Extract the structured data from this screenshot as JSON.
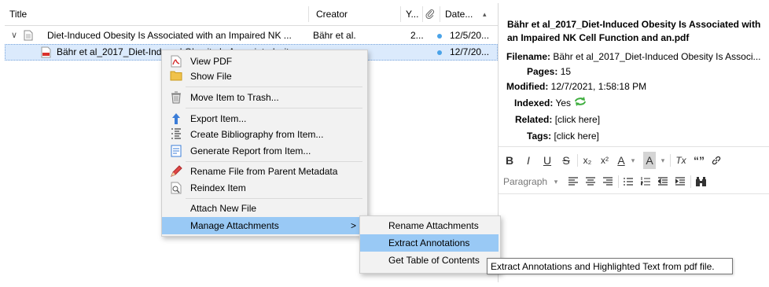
{
  "columns": {
    "title": "Title",
    "creator": "Creator",
    "year": "Y...",
    "attachment_icon": "paperclip-icon",
    "date": "Date...",
    "sort_indicator": "▴"
  },
  "rows": [
    {
      "title": "Diet-Induced Obesity Is Associated with an Impaired NK ...",
      "creator": "Bähr et al.",
      "year": "2...",
      "date": "12/5/20...",
      "expand_glyph": "∨"
    },
    {
      "title": "Bähr et al_2017_Diet-Induced Obesity Is Associated wit...",
      "creator": "",
      "year": "",
      "date": "12/7/20..."
    }
  ],
  "context_menu": {
    "items": [
      {
        "label": "View PDF",
        "icon": "pdf-icon"
      },
      {
        "label": "Show File",
        "icon": "folder-icon"
      },
      {
        "label": "Move Item to Trash...",
        "icon": "trash-icon"
      },
      {
        "label": "Export Item...",
        "icon": "export-arrow-icon"
      },
      {
        "label": "Create Bibliography from Item...",
        "icon": "bibliography-icon"
      },
      {
        "label": "Generate Report from Item...",
        "icon": "report-icon"
      },
      {
        "label": "Rename File from Parent Metadata",
        "icon": "rename-pencil-icon"
      },
      {
        "label": "Reindex Item",
        "icon": "reindex-icon"
      },
      {
        "label": "Attach New File",
        "icon": ""
      },
      {
        "label": "Manage Attachments",
        "icon": "",
        "submenu_arrow": ">"
      }
    ]
  },
  "submenu": {
    "items": [
      "Rename Attachments",
      "Extract Annotations",
      "Get Table of Contents"
    ]
  },
  "tooltip": "Extract Annotations and Highlighted Text from pdf file.",
  "info": {
    "title": "Bähr et al_2017_Diet-Induced Obesity Is Associated with an Impaired NK Cell Function and an.pdf",
    "filename_label": "Filename:",
    "filename_value": "Bähr et al_2017_Diet-Induced Obesity Is Associ...",
    "pages_label": "Pages:",
    "pages_value": "15",
    "modified_label": "Modified:",
    "modified_value": "12/7/2021, 1:58:18 PM",
    "indexed_label": "Indexed:",
    "indexed_value": "Yes",
    "related_label": "Related:",
    "related_value": "[click here]",
    "tags_label": "Tags:",
    "tags_value": "[click here]"
  },
  "editor_toolbar": {
    "row1": [
      "B",
      "I",
      "U",
      "S",
      "x₂",
      "x²",
      "A",
      "A",
      "Tx",
      "“”",
      "link"
    ],
    "paragraph_label": "Paragraph"
  },
  "colors": {
    "selection": "#dbeafc",
    "menu_highlight": "#99c9f5",
    "attachment_dot": "#4aa3e8"
  }
}
